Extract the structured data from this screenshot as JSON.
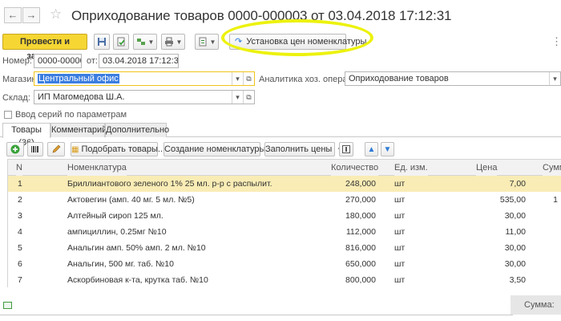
{
  "window": {
    "title": "Оприходование товаров 0000-000003 от 03.04.2018 17:12:31",
    "nav_back": "←",
    "nav_forward": "→",
    "favorite_icon": "star-icon"
  },
  "toolbar": {
    "post_and_close": "Провести и закрыть",
    "set_prices": "Установка цен номенклатуры",
    "more": "⋮"
  },
  "form": {
    "number_label": "Номер:",
    "number_value": "0000-000003",
    "date_label": "от:",
    "date_value": "03.04.2018 17:12:31",
    "store_label": "Магазин:",
    "store_value": "Центральный офис",
    "analytics_label": "Аналитика хоз. операции:",
    "analytics_value": "Оприходование товаров",
    "warehouse_label": "Склад:",
    "warehouse_value": "ИП Магомедова Ш.А.",
    "series_checkbox_label": "Ввод серий по параметрам"
  },
  "tabs": [
    {
      "label": "Товары (36)",
      "active": true
    },
    {
      "label": "Комментарий",
      "active": false
    },
    {
      "label": "Дополнительно",
      "active": false
    }
  ],
  "table_toolbar": {
    "pick_goods": "Подобрать товары...",
    "create_item": "Создание номенклатуры",
    "fill_prices": "Заполнить цены"
  },
  "table": {
    "headers": {
      "n": "N",
      "name": "Номенклатура",
      "qty": "Количество",
      "unit": "Ед. изм.",
      "price": "Цена",
      "sum": "Сумма"
    },
    "rows": [
      {
        "n": "1",
        "name": "Бриллиантового зеленого 1% 25 мл. р-р с распылит.",
        "qty": "248,000",
        "unit": "шт",
        "price": "7,00",
        "sum": "",
        "selected": true
      },
      {
        "n": "2",
        "name": "Актовегин (амп. 40 мг. 5 мл. №5)",
        "qty": "270,000",
        "unit": "шт",
        "price": "535,00",
        "sum": "1",
        "selected": false
      },
      {
        "n": "3",
        "name": "Алтейный сироп 125 мл.",
        "qty": "180,000",
        "unit": "шт",
        "price": "30,00",
        "sum": "",
        "selected": false
      },
      {
        "n": "4",
        "name": "ампициллин, 0.25мг №10",
        "qty": "112,000",
        "unit": "шт",
        "price": "11,00",
        "sum": "",
        "selected": false
      },
      {
        "n": "5",
        "name": "Анальгин амп. 50% амп. 2 мл. №10",
        "qty": "816,000",
        "unit": "шт",
        "price": "30,00",
        "sum": "",
        "selected": false
      },
      {
        "n": "6",
        "name": "Анальгин, 500 мг. таб. №10",
        "qty": "650,000",
        "unit": "шт",
        "price": "30,00",
        "sum": "",
        "selected": false
      },
      {
        "n": "7",
        "name": "Аскорбиновая к-та, крутка таб. №10",
        "qty": "800,000",
        "unit": "шт",
        "price": "3,50",
        "sum": "",
        "selected": false
      }
    ]
  },
  "footer": {
    "sum_label": "Сумма:"
  },
  "colors": {
    "primary_button": "#f5d633",
    "selected_row": "#f9ecb5",
    "highlight_marker": "#ecf20d",
    "selection_blue": "#3b7de0"
  }
}
